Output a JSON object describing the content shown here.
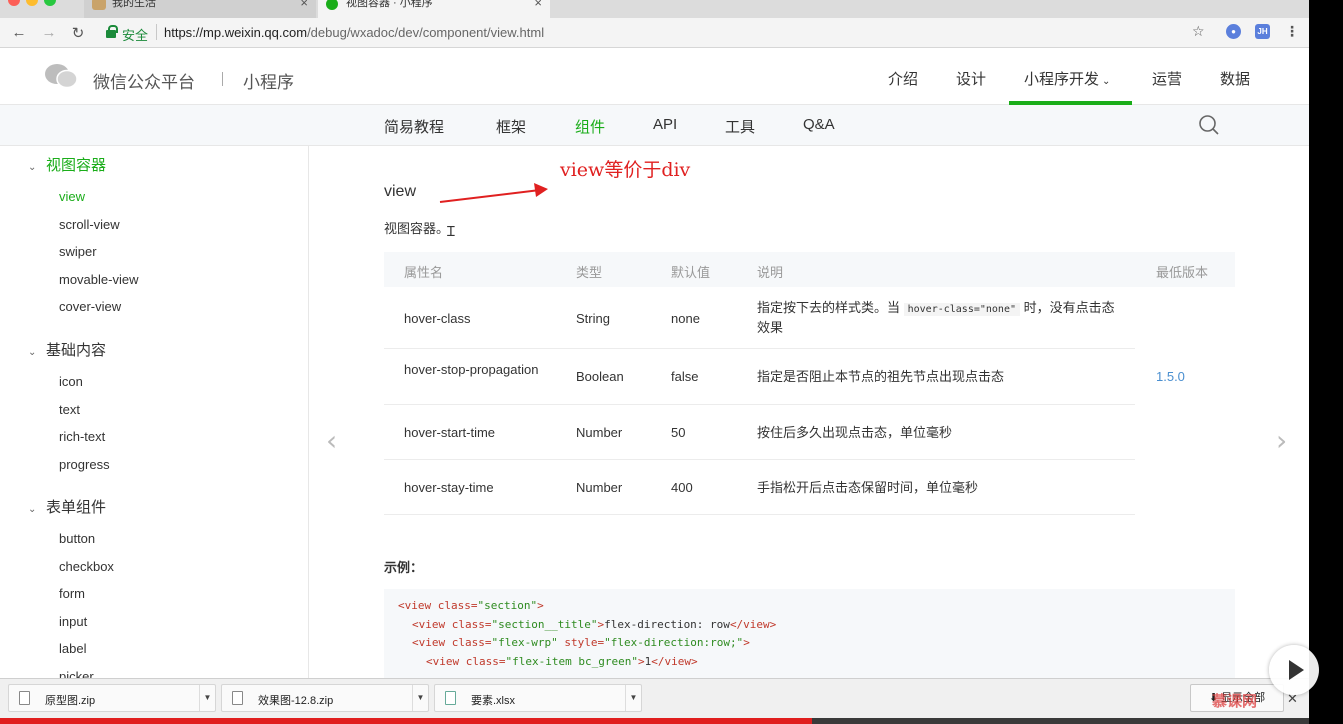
{
  "browser": {
    "tabs": [
      {
        "title": "我的生活",
        "active": false
      },
      {
        "title": "视图容器 · 小程序",
        "active": true
      }
    ],
    "secure_label": "安全",
    "url_host": "https://mp.weixin.qq.com",
    "url_path": "/debug/wxadoc/dev/component/view.html",
    "ext_badge": "JH",
    "colors": {
      "secure": "#1b8a3a",
      "accent_green": "#1aad19",
      "link_blue": "#4a8fd0",
      "annotation_red": "#e02020"
    }
  },
  "header": {
    "site_name": "微信公众平台",
    "site_sub": "小程序",
    "nav": [
      "介绍",
      "设计",
      "小程序开发",
      "运营",
      "数据"
    ],
    "nav_active": "小程序开发"
  },
  "subnav": {
    "items": [
      "简易教程",
      "框架",
      "组件",
      "API",
      "工具",
      "Q&A"
    ],
    "active": "组件"
  },
  "sidebar": {
    "groups": [
      {
        "label": "视图容器",
        "items": [
          "view",
          "scroll-view",
          "swiper",
          "movable-view",
          "cover-view"
        ]
      },
      {
        "label": "基础内容",
        "items": [
          "icon",
          "text",
          "rich-text",
          "progress"
        ]
      },
      {
        "label": "表单组件",
        "items": [
          "button",
          "checkbox",
          "form",
          "input",
          "label",
          "picker"
        ]
      }
    ],
    "active_item": "view"
  },
  "content": {
    "annotation": "view等价于div",
    "title": "view",
    "description": "视图容器。",
    "table": {
      "headers": [
        "属性名",
        "类型",
        "默认值",
        "说明",
        "最低版本"
      ],
      "rows": [
        {
          "name": "hover-class",
          "type": "String",
          "default": "none",
          "desc_pre": "指定按下去的样式类。当 ",
          "desc_code": "hover-class=\"none\"",
          "desc_post": " 时，没有点击态效果",
          "version": ""
        },
        {
          "name": "hover-stop-propagation",
          "type": "Boolean",
          "default": "false",
          "desc_pre": "指定是否阻止本节点的祖先节点出现点击态",
          "desc_code": "",
          "desc_post": "",
          "version": "1.5.0"
        },
        {
          "name": "hover-start-time",
          "type": "Number",
          "default": "50",
          "desc_pre": "按住后多久出现点击态，单位毫秒",
          "desc_code": "",
          "desc_post": "",
          "version": ""
        },
        {
          "name": "hover-stay-time",
          "type": "Number",
          "default": "400",
          "desc_pre": "手指松开后点击态保留时间，单位毫秒",
          "desc_code": "",
          "desc_post": "",
          "version": ""
        }
      ]
    },
    "example_label": "示例：",
    "code": [
      {
        "indent": 0,
        "tag": "view",
        "attrs": [
          [
            "class",
            "\"section\""
          ]
        ],
        "text": "",
        "close": false
      },
      {
        "indent": 1,
        "tag": "view",
        "attrs": [
          [
            "class",
            "\"section__title\""
          ]
        ],
        "text": "flex-direction: row",
        "close": true
      },
      {
        "indent": 1,
        "tag": "view",
        "attrs": [
          [
            "class",
            "\"flex-wrp\""
          ],
          [
            "style",
            "\"flex-direction:row;\""
          ]
        ],
        "text": "",
        "close": false
      },
      {
        "indent": 2,
        "tag": "view",
        "attrs": [
          [
            "class",
            "\"flex-item bc_green\""
          ]
        ],
        "text": "1",
        "close": true
      }
    ]
  },
  "downloads": {
    "items": [
      "原型图.zip",
      "效果图-12.8.zip",
      "要素.xlsx"
    ],
    "show_all": "显示全部"
  },
  "video": {
    "progress": 0.62,
    "watermark": "慕课网"
  }
}
